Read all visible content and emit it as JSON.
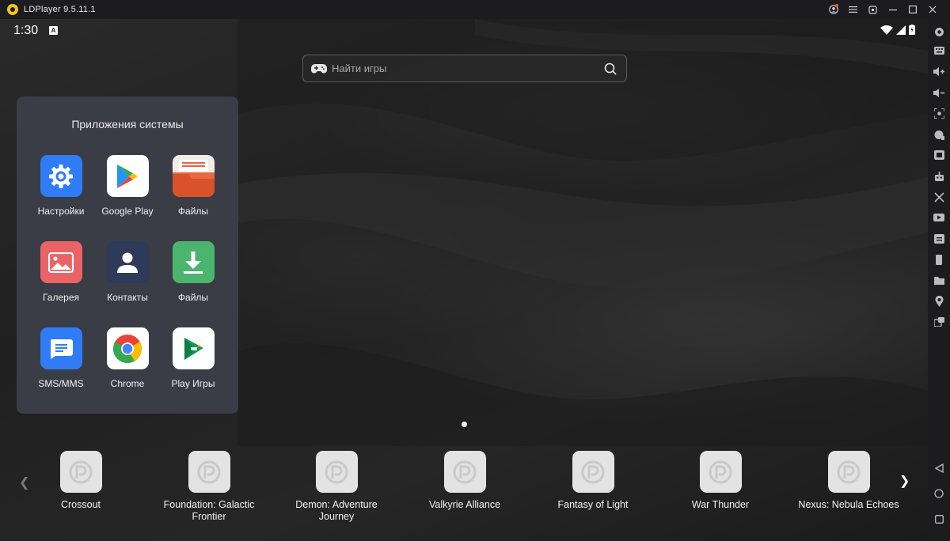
{
  "window": {
    "title": "LDPlayer 9.5.11.1"
  },
  "status": {
    "time": "1:30",
    "badge": "A"
  },
  "search": {
    "placeholder": "Найти игры"
  },
  "folder": {
    "title": "Приложения системы",
    "apps": [
      {
        "label": "Настройки",
        "icon": "settings-icon",
        "color": "#2f7cf6"
      },
      {
        "label": "Google Play",
        "icon": "google-play-icon",
        "color": "#ffffff"
      },
      {
        "label": "Файлы",
        "icon": "files-icon",
        "color": "#e8683f"
      },
      {
        "label": "Галерея",
        "icon": "gallery-icon",
        "color": "#ea6466"
      },
      {
        "label": "Контакты",
        "icon": "contacts-icon",
        "color": "#2e3a5a"
      },
      {
        "label": "Файлы",
        "icon": "download-icon",
        "color": "#4bb56f"
      },
      {
        "label": "SMS/MMS",
        "icon": "messages-icon",
        "color": "#2f7cf6"
      },
      {
        "label": "Chrome",
        "icon": "chrome-icon",
        "color": "#ffffff"
      },
      {
        "label": "Play Игры",
        "icon": "play-games-icon",
        "color": "#ffffff"
      }
    ]
  },
  "games": [
    {
      "label": "Crossout"
    },
    {
      "label": "Foundation: Galactic Frontier"
    },
    {
      "label": "Demon: Adventure Journey"
    },
    {
      "label": "Valkyrie Alliance"
    },
    {
      "label": "Fantasy of Light"
    },
    {
      "label": "War Thunder"
    },
    {
      "label": "Nexus: Nebula Echoes"
    }
  ],
  "toolbar": {
    "icons": [
      "settings-gear-icon",
      "keyboard-icon",
      "volume-up-icon",
      "volume-down-icon",
      "screenshot-icon",
      "install-apk-icon",
      "multi-instance-icon",
      "operation-recorder-icon",
      "scissors-icon",
      "record-video-icon",
      "sync-icon",
      "shake-icon",
      "shared-folder-icon",
      "location-icon",
      "rotate-icon",
      "back-icon",
      "home-icon",
      "recents-icon"
    ]
  }
}
